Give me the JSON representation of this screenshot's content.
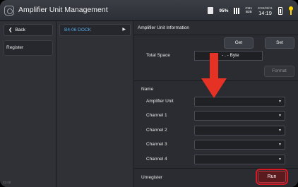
{
  "window": {
    "title": "Amplifier Unit Management"
  },
  "status_bar": {
    "storage_percent": "95%",
    "channel_line1": "CH1",
    "channel_line2": "B2B",
    "date": "2015/09/21",
    "time": "14:19",
    "colors": {
      "accent_indicator": "#ffd400"
    }
  },
  "left_nav": {
    "back_label": "Back",
    "back_icon": "chevron-left-icon",
    "register_label": "Register",
    "version": "02.00"
  },
  "device_list": {
    "selected_item": "B4-06  DOCK",
    "arrow_icon": "triangle-right-icon",
    "colors": {
      "item_text": "#54a9e8"
    }
  },
  "panel": {
    "header": "Amplifier Unit Information",
    "get_label": "Get",
    "set_label": "Set",
    "total_space_label": "Total Space",
    "total_space_value": "- . - Byte",
    "format_label": "Format",
    "name_label": "Name",
    "fields": [
      {
        "label": "Amplifier Unit",
        "value": ""
      },
      {
        "label": "Channel 1",
        "value": ""
      },
      {
        "label": "Channel 2",
        "value": ""
      },
      {
        "label": "Channel 3",
        "value": ""
      },
      {
        "label": "Channel 4",
        "value": ""
      }
    ],
    "unregister_label": "Unregister",
    "run_label": "Run",
    "dropdown_icon": "triangle-down-icon",
    "colors": {
      "run_border": "#d31a25",
      "annotation_arrow": "#e53225"
    }
  }
}
